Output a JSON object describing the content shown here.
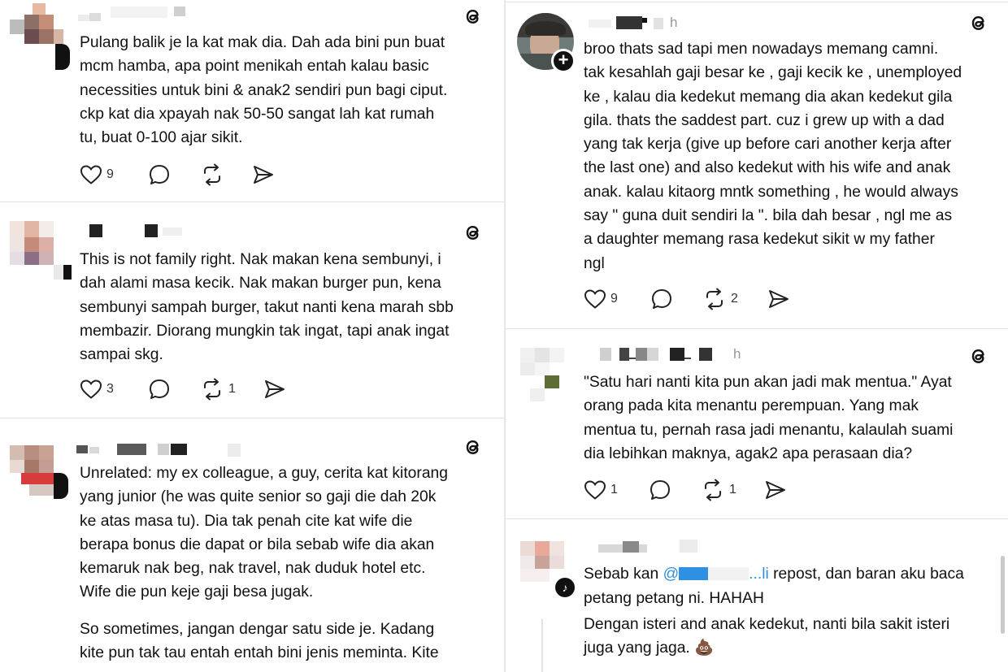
{
  "app": {
    "name": "Threads",
    "icon": "threads-logo-icon"
  },
  "left_column": {
    "posts": [
      {
        "username": "",
        "text": "Pulang balik je la kat mak dia. Dah ada bini pun buat\nmcm hamba, apa point menikah entah kalau basic\nnecessities untuk bini & anak2 sendiri pun bagi ciput.\nckp kat dia xpayah nak 50-50 sangat lah kat rumah\ntu, buat 0-100 ajar sikit.",
        "likes": "9",
        "replies": "",
        "reposts": ""
      },
      {
        "username": "",
        "text": "This is not family right. Nak makan kena sembunyi, i\ndah alami masa kecik. Nak makan burger pun, kena\nsembunyi sampah burger, takut nanti kena marah sbb\nmembazir. Diorang mungkin tak ingat, tapi anak ingat\nsampai skg.",
        "likes": "3",
        "replies": "",
        "reposts": "1"
      },
      {
        "username": "",
        "text": "Unrelated: my ex colleague, a guy, cerita kat kitorang\nyang junior (he was quite senior so gaji die dah 20k\nke atas masa tu). Dia tak penah cite kat wife die\nberapa bonus die dapat or bila sebab wife dia akan\nkemaruk nak beg, nak travel, nak duduk hotel etc.\nWife die pun keje gaji besa jugak.",
        "text2": "So sometimes, jangan dengar satu side je. Kadang\nkite pun tak tau entah entah bini jenis meminta. Kite"
      }
    ]
  },
  "right_column": {
    "posts": [
      {
        "username": "",
        "timestamp": "h",
        "text": "broo thats sad tapi men nowadays memang camni.\ntak kesahlah gaji besar ke , gaji kecik ke , unemployed\nke , kalau dia kedekut memang dia akan kedekut gila\ngila. thats the saddest part. cuz i grew up with a dad\nyang tak kerja (give up before cari another kerja after\nthe last one) and also kedekut with his wife and anak\nanak. kalau kitaorg mntk something , he would always\nsay \" guna duit sendiri la \". bila dah besar , ngl me as\na daughter memang rasa kedekut sikit w my father\nngl",
        "likes": "9",
        "replies": "",
        "reposts": "2"
      },
      {
        "username": "",
        "timestamp": "h",
        "text": "\"Satu hari nanti kita pun akan jadi mak mentua.\" Ayat\norang pada kita menantu perempuan. Yang mak\nmentua tu, pernah rasa jadi menantu, kalaulah suami\ndia lebihkan maknya, agak2 apa perasaan dia?",
        "likes": "1",
        "replies": "",
        "reposts": "1"
      },
      {
        "username": "",
        "text_before_mention": "Sebab kan ",
        "mention_prefix": "@",
        "mention_suffix": "...li",
        "text_after_mention": " repost, dan baran aku baca",
        "text_line2": "petang petang ni. HAHAH",
        "text_para2": "Dengan isteri and anak kedekut, nanti bila sakit isteri\njuga yang jaga. 💩"
      }
    ]
  },
  "icons": {
    "like": "heart-icon",
    "reply": "comment-bubble-icon",
    "repost": "repost-icon",
    "share": "send-icon",
    "follow": "plus-icon"
  },
  "colors": {
    "text": "#111111",
    "muted": "#333333",
    "mention": "#2f8fe0",
    "divider": "#e3e3e3"
  }
}
